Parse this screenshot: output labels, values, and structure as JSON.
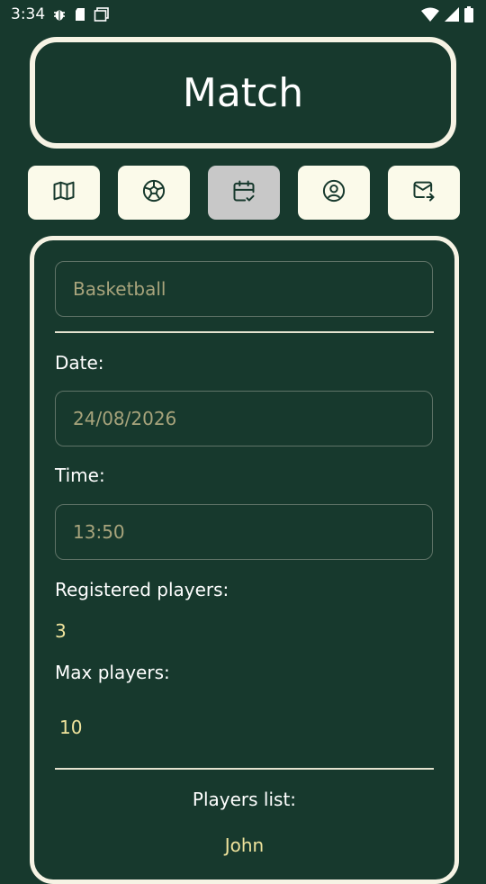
{
  "status_bar": {
    "time": "3:34",
    "left_icons": [
      "bug-icon",
      "sd-card-icon",
      "screenshot-icon"
    ],
    "right_icons": [
      "wifi-icon",
      "cell-signal-icon",
      "battery-icon"
    ]
  },
  "header": {
    "title": "Match"
  },
  "nav": {
    "items": [
      {
        "icon": "map-icon",
        "active": false
      },
      {
        "icon": "soccer-ball-icon",
        "active": false
      },
      {
        "icon": "calendar-check-icon",
        "active": true
      },
      {
        "icon": "user-circle-icon",
        "active": false
      },
      {
        "icon": "mail-forward-icon",
        "active": false
      }
    ]
  },
  "match": {
    "sport": "Basketball",
    "date_label": "Date:",
    "date_value": "24/08/2026",
    "time_label": "Time:",
    "time_value": "13:50",
    "registered_label": "Registered players:",
    "registered_value": "3",
    "max_label": "Max players:",
    "max_value": "10",
    "players_list_label": "Players list:",
    "players": [
      "John"
    ]
  },
  "colors": {
    "background": "#17392d",
    "card_border": "#f6f3e4",
    "nav_button": "#fbfaea",
    "nav_button_active": "#c8c8c8",
    "value_text": "#efe39c",
    "field_text": "#a8a47c"
  }
}
